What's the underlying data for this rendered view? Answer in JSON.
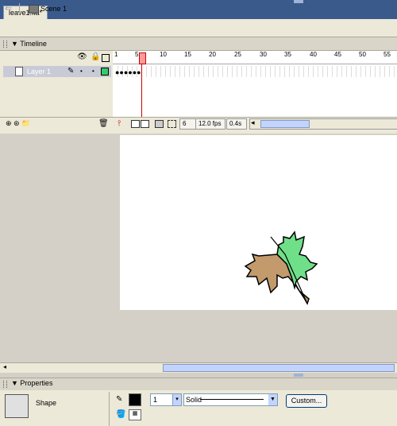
{
  "document": {
    "tab_label": "leave1.fla*"
  },
  "scenebar": {
    "scene_label": "Scene 1"
  },
  "timeline": {
    "title": "Timeline",
    "ruler_ticks": [
      "1",
      "5",
      "10",
      "15",
      "20",
      "25",
      "30",
      "35",
      "40",
      "45",
      "50",
      "55"
    ],
    "layer": {
      "name": "Layer 1"
    },
    "current_frame": "6",
    "frame_rate": "12.0 fps",
    "elapsed_time": "0.4s"
  },
  "properties": {
    "title": "Properties",
    "selection_type": "Shape",
    "stroke_height": "1",
    "stroke_style": "Solid",
    "custom_button": "Custom..."
  },
  "colors": {
    "stroke": "#000000",
    "layer_outline": "#33cc66",
    "leaf_green": "#6fe089",
    "leaf_brown": "#c39a6c"
  }
}
